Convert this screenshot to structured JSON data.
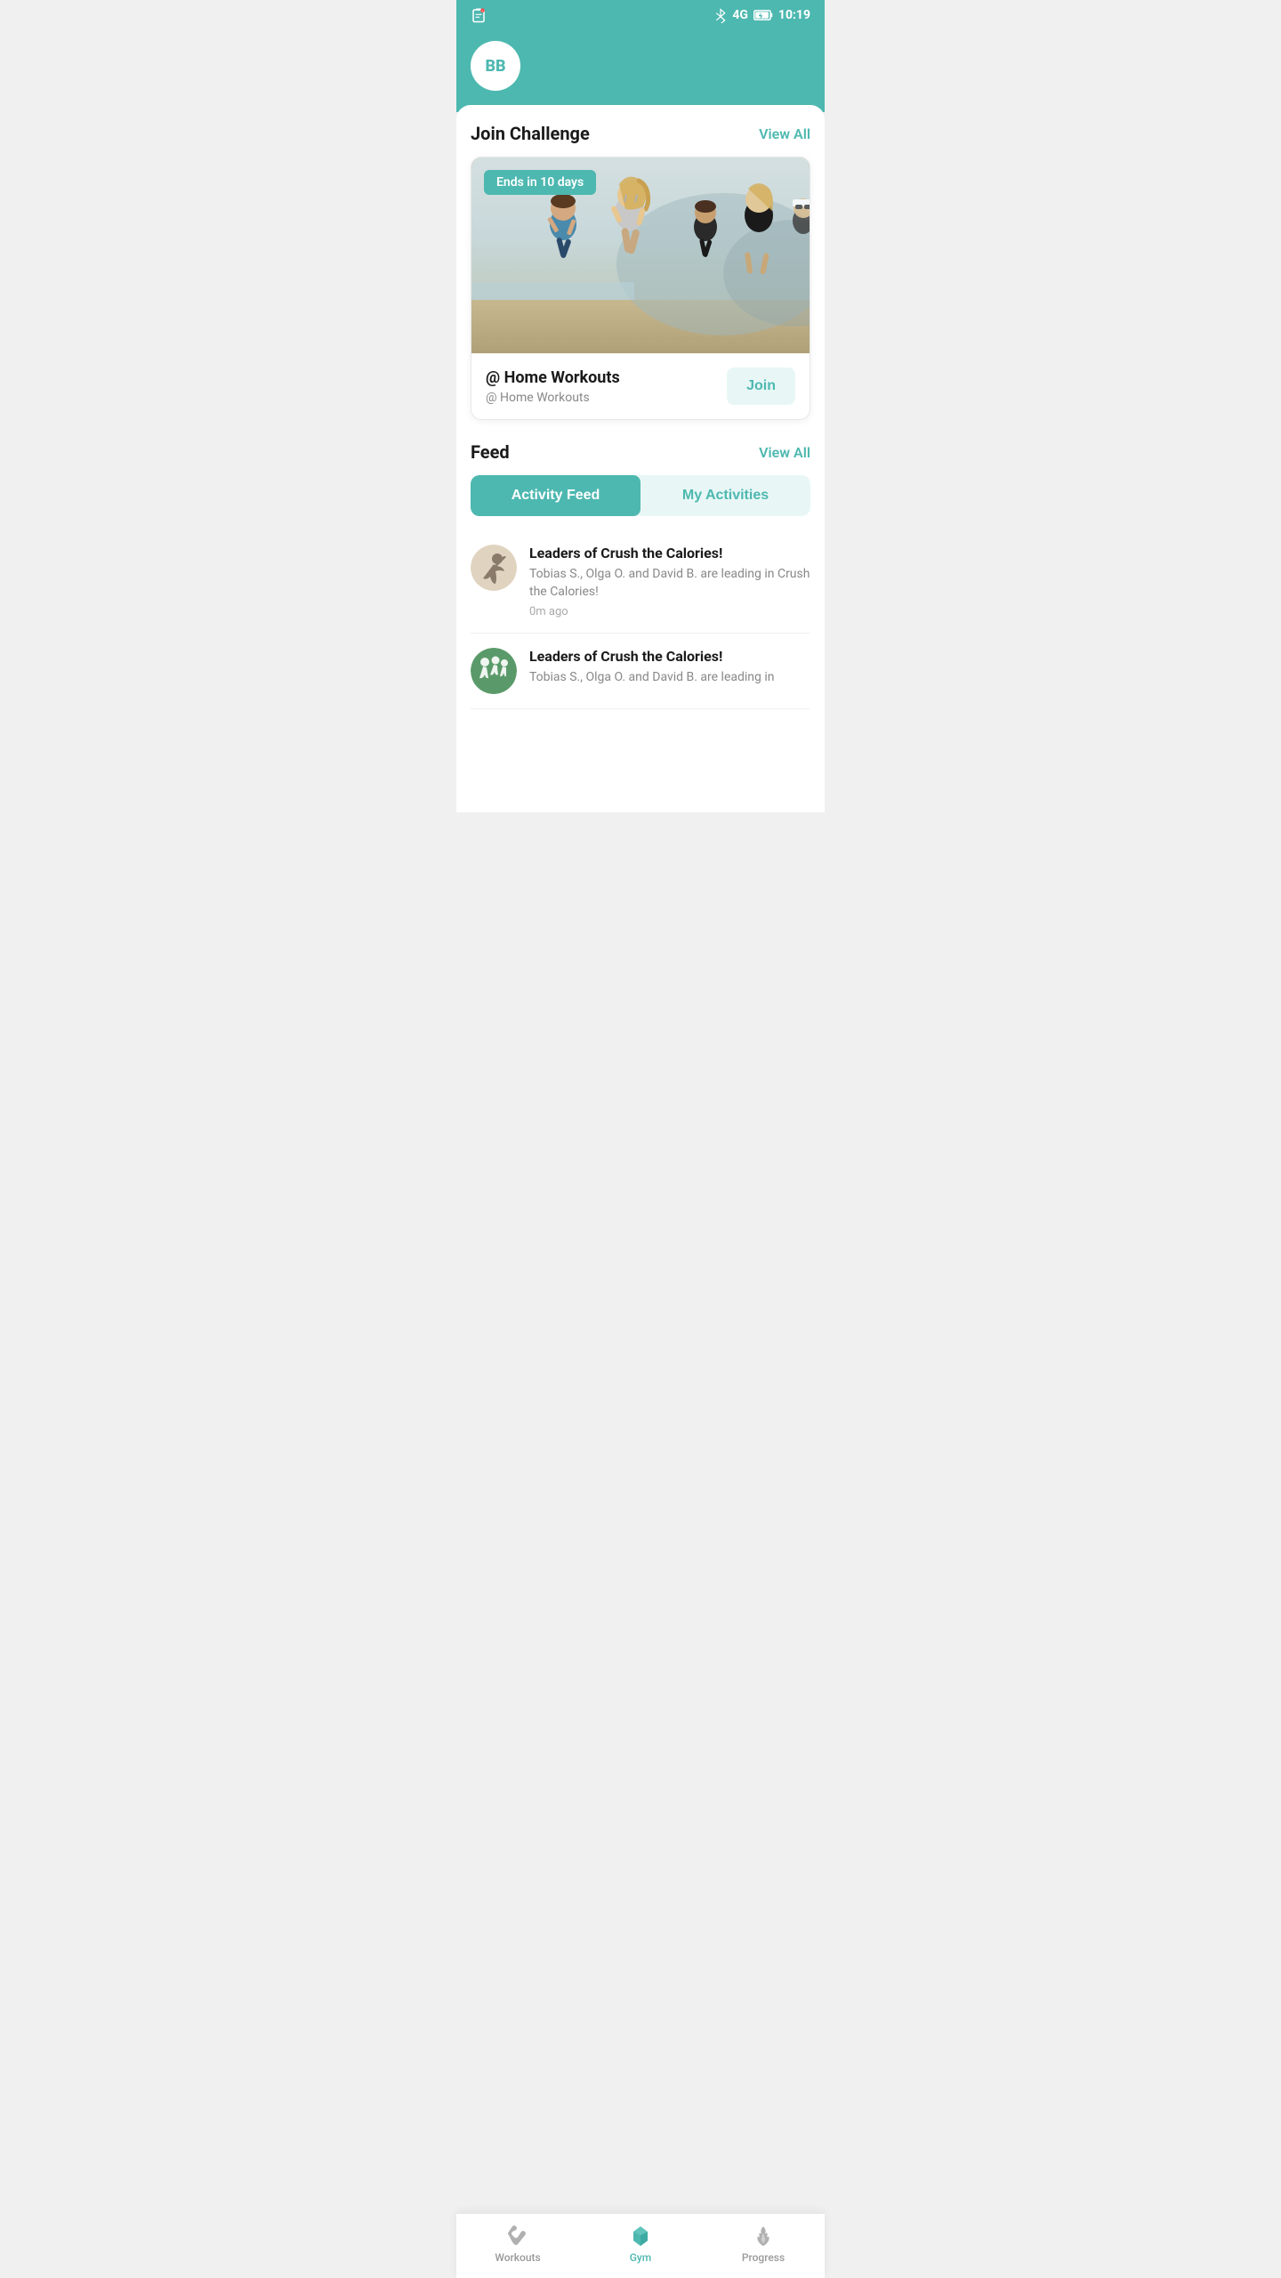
{
  "statusBar": {
    "time": "10:19",
    "bluetooth": "BT",
    "network": "4G"
  },
  "header": {
    "avatarInitials": "BB"
  },
  "joinChallenge": {
    "title": "Join Challenge",
    "viewAll": "View All",
    "badge": "Ends in 10 days",
    "cardTitle": "@ Home Workouts",
    "cardSubtitle": "@ Home Workouts",
    "joinButton": "Join"
  },
  "feed": {
    "title": "Feed",
    "viewAll": "View All",
    "tabs": {
      "activityFeed": "Activity Feed",
      "myActivities": "My Activities"
    },
    "items": [
      {
        "title": "Leaders of Crush the Calories!",
        "description": "Tobias S., Olga O. and David B. are leading in Crush the Calories!",
        "time": "0m ago"
      },
      {
        "title": "Leaders of Crush the Calories!",
        "description": "Tobias S., Olga O. and David B. are leading in",
        "time": ""
      }
    ]
  },
  "bottomNav": {
    "items": [
      {
        "label": "Workouts",
        "icon": "dumbbell-icon",
        "active": false
      },
      {
        "label": "Gym",
        "icon": "gym-icon",
        "active": true
      },
      {
        "label": "Progress",
        "icon": "progress-icon",
        "active": false
      }
    ]
  },
  "colors": {
    "primary": "#4db8b0",
    "primaryLight": "#e8f7f6",
    "dark": "#1a1a1a",
    "gray": "#888888",
    "lightGray": "#f0f0f0"
  }
}
